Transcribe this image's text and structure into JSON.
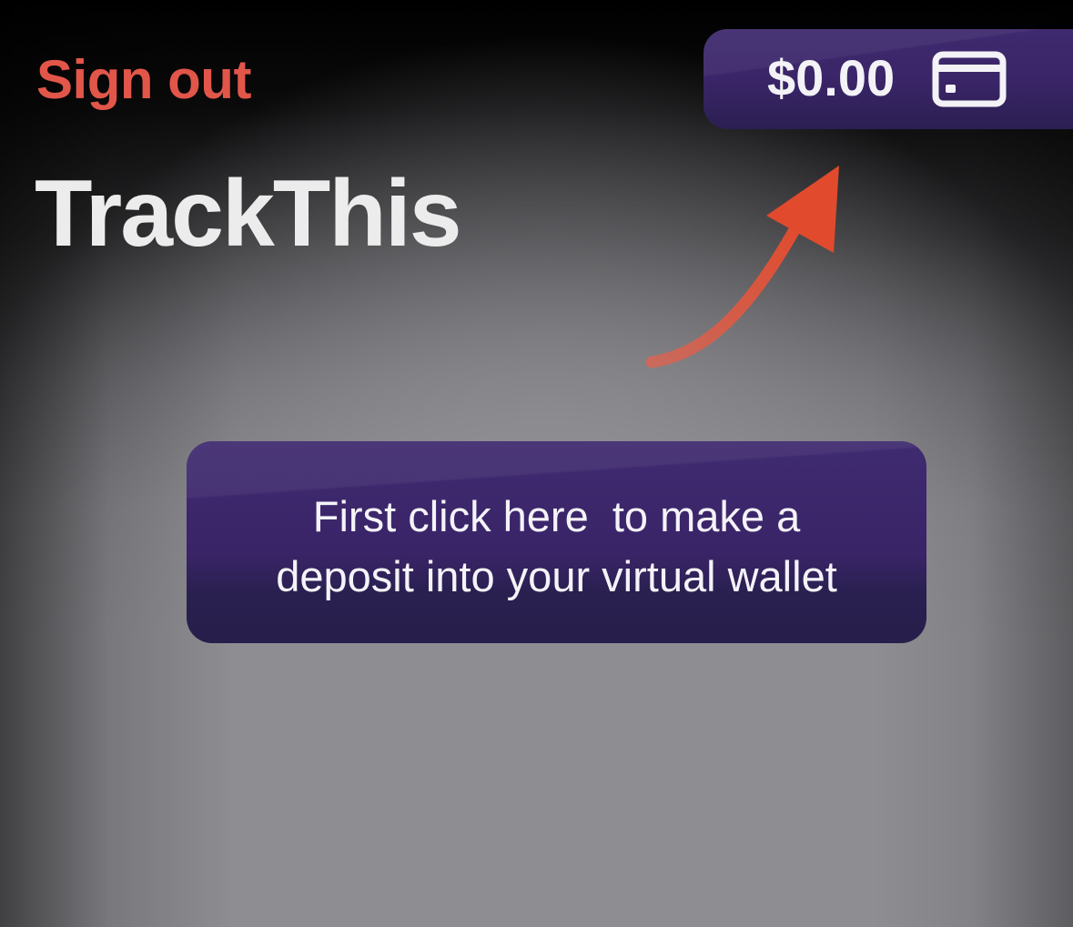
{
  "header": {
    "sign_out_label": "Sign out",
    "app_title": "TrackThis"
  },
  "wallet": {
    "balance": "$0.00",
    "icon": "credit-card-icon"
  },
  "tooltip": {
    "line1": "First click here  to make a",
    "line2": "deposit into your virtual wallet",
    "pointer_icon": "curved-arrow-icon"
  },
  "colors": {
    "accent_red": "#e2564a",
    "wallet_purple": "#3a2568",
    "arrow_red": "#e04a30",
    "title_text": "#ececec"
  }
}
